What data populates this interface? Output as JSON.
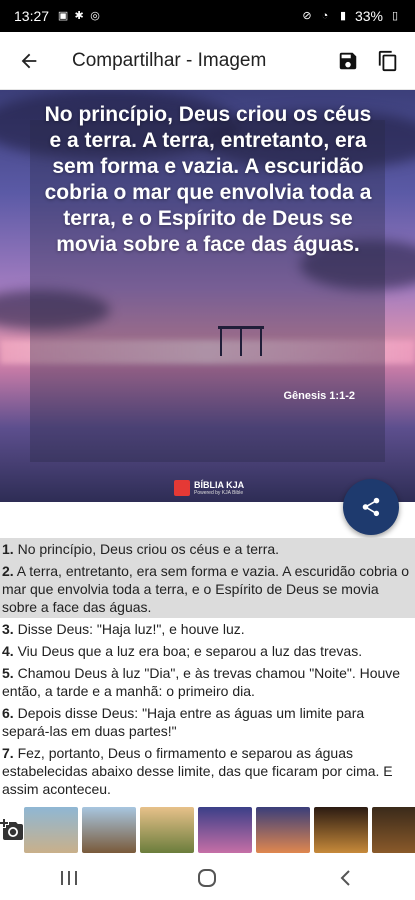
{
  "status_bar": {
    "time": "13:27",
    "battery": "33%",
    "left_icons": [
      "gallery-icon",
      "pinwheel-icon",
      "whatsapp-icon"
    ],
    "right_icons": [
      "mute-icon",
      "wifi-icon",
      "signal-icon",
      "battery-icon"
    ]
  },
  "app_bar": {
    "title": "Compartilhar - Imagem",
    "icons": [
      "back-arrow-icon",
      "save-icon",
      "copy-icon"
    ]
  },
  "image": {
    "verse_text": "No princípio, Deus criou os céus e a terra. A terra, entretanto, era sem forma e vazia. A escuridão cobria o mar que envolvia toda a terra, e o Espírito de Deus se movia sobre a face das águas.",
    "reference": "Gênesis 1:1-2",
    "brand_name": "BÍBLIA KJA",
    "brand_sub": "Powered by KJA Bible"
  },
  "verses": [
    {
      "num": "1.",
      "text": " No princípio, Deus criou os céus e a terra.",
      "selected": true
    },
    {
      "num": "2.",
      "text": " A terra, entretanto, era sem forma e vazia. A escuridão cobria o mar que envolvia toda a terra, e o Espírito de Deus se movia sobre a face das águas.",
      "selected": true
    },
    {
      "num": "3.",
      "text": " Disse Deus: \"Haja luz!\", e houve luz.",
      "selected": false
    },
    {
      "num": "4.",
      "text": " Viu Deus que a luz era boa; e separou a luz das trevas.",
      "selected": false
    },
    {
      "num": "5.",
      "text": " Chamou Deus à luz \"Dia\", e às trevas chamou \"Noite\". Houve então, a tarde e a manhã: o primeiro dia.",
      "selected": false
    },
    {
      "num": "6.",
      "text": " Depois disse Deus: \"Haja entre as águas um limite para separá-las em duas partes!\"",
      "selected": false
    },
    {
      "num": "7.",
      "text": " Fez, portanto, Deus o firmamento e separou as águas estabelecidas abaixo desse limite, das que ficaram por cima. E assim aconteceu.",
      "selected": false
    }
  ],
  "thumbnails": [
    {
      "name": "thumb-pier",
      "colors": [
        "#8fb7d4",
        "#c9b08a"
      ]
    },
    {
      "name": "thumb-dock",
      "colors": [
        "#a8c6e0",
        "#7a5a3a"
      ]
    },
    {
      "name": "thumb-field",
      "colors": [
        "#e7c18a",
        "#6b7d3c"
      ]
    },
    {
      "name": "thumb-purple-sea",
      "colors": [
        "#3b3f88",
        "#c66fa6"
      ]
    },
    {
      "name": "thumb-sunset",
      "colors": [
        "#3a3e7a",
        "#e0874f"
      ]
    },
    {
      "name": "thumb-bokeh",
      "colors": [
        "#2b1b12",
        "#c78a3a"
      ]
    },
    {
      "name": "thumb-dark",
      "colors": [
        "#3a2a1a",
        "#8a5a2a"
      ]
    }
  ],
  "colors": {
    "fab": "#1e3a6e",
    "selected_bg": "#dcdcdc"
  }
}
